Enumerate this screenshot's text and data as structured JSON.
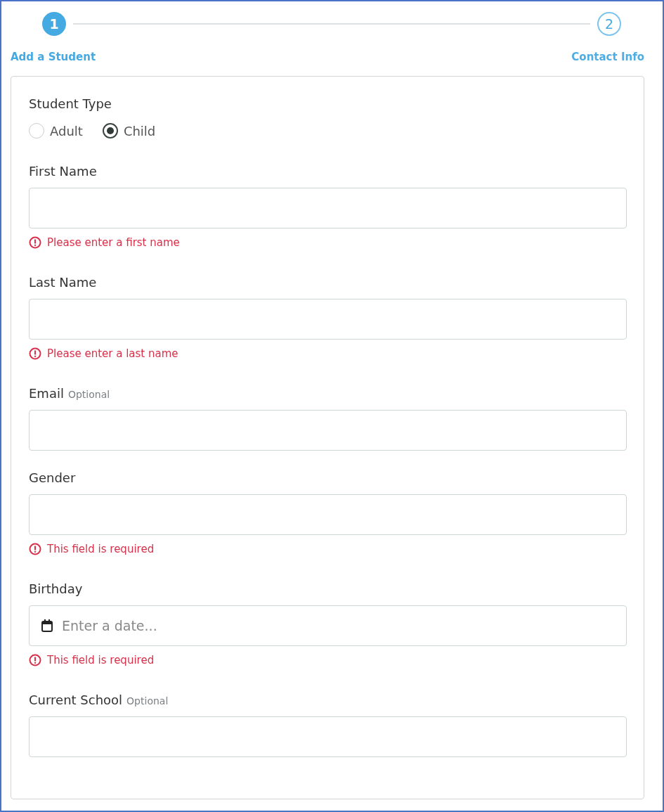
{
  "steps": [
    {
      "number": "1",
      "label": "Add a Student",
      "selected": true
    },
    {
      "number": "2",
      "label": "Contact Info",
      "selected": false
    }
  ],
  "student_type": {
    "label": "Student Type",
    "options": [
      {
        "label": "Adult",
        "selected": false
      },
      {
        "label": "Child",
        "selected": true
      }
    ]
  },
  "fields": [
    {
      "kind": "text",
      "label": "First Name",
      "error": "Please enter a first name"
    },
    {
      "kind": "text",
      "label": "Last Name",
      "error": "Please enter a last name"
    },
    {
      "kind": "text",
      "label": "Email",
      "tag": "Optional"
    },
    {
      "kind": "text",
      "label": "Gender",
      "error": "This field is required"
    },
    {
      "kind": "date",
      "label": "Birthday",
      "placeholder": "Enter a date...",
      "error": "This field is required"
    },
    {
      "kind": "text",
      "label": "Current School",
      "tag": "Optional"
    }
  ]
}
